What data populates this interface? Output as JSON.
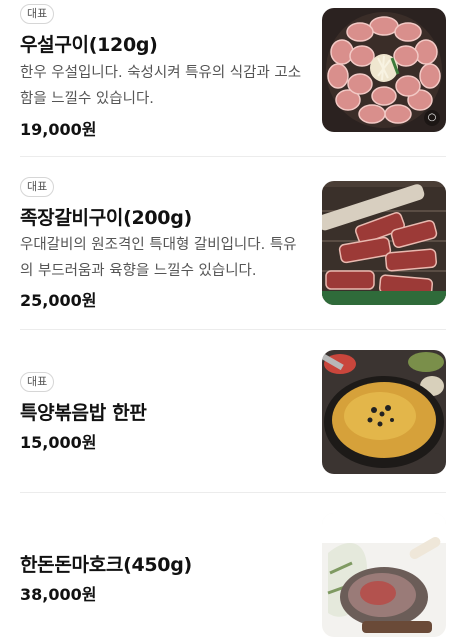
{
  "menu": {
    "items": [
      {
        "badge": "대표",
        "name": "우설구이(120g)",
        "description": "한우 우설입니다. 숙성시켜 특유의 식감과 고소함을 느낄수 있습니다.",
        "price": "19,000원",
        "image_icon": "beef-tongue-photo"
      },
      {
        "badge": "대표",
        "name": "족장갈비구이(200g)",
        "description": "우대갈비의 원조격인 특대형 갈비입니다. 특유의 부드러움과 육향을 느낄수 있습니다.",
        "price": "25,000원",
        "image_icon": "galbi-photo"
      },
      {
        "badge": "대표",
        "name": "특양볶음밥 한판",
        "description": "",
        "price": "15,000원",
        "image_icon": "fried-rice-photo"
      },
      {
        "badge": "",
        "name": "한돈돈마호크(450g)",
        "description": "",
        "price": "38,000원",
        "image_icon": "tomahawk-photo"
      }
    ]
  }
}
